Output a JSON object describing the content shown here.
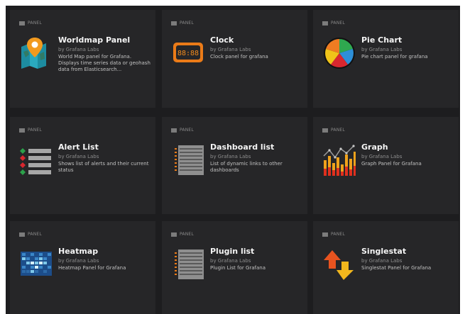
{
  "cards": [
    {
      "tag": "PANEL",
      "title": "Worldmap Panel",
      "author": "by Grafana Labs",
      "desc": "World Map panel for Grafana. Displays time series data or geohash data from Elasticsearch...",
      "logo": "worldmap-icon"
    },
    {
      "tag": "PANEL",
      "title": "Clock",
      "author": "by Grafana Labs",
      "desc": "Clock panel for grafana",
      "logo": "clock-icon",
      "logo_text": "88:88"
    },
    {
      "tag": "PANEL",
      "title": "Pie Chart",
      "author": "by Grafana Labs",
      "desc": "Pie chart panel for grafana",
      "logo": "pie-chart-icon"
    },
    {
      "tag": "PANEL",
      "title": "Alert List",
      "author": "by Grafana Labs",
      "desc": "Shows list of alerts and their current status",
      "logo": "alert-list-icon"
    },
    {
      "tag": "PANEL",
      "title": "Dashboard list",
      "author": "by Grafana Labs",
      "desc": "List of dynamic links to other dashboards",
      "logo": "dashboard-list-icon"
    },
    {
      "tag": "PANEL",
      "title": "Graph",
      "author": "by Grafana Labs",
      "desc": "Graph Panel for Grafana",
      "logo": "graph-icon"
    },
    {
      "tag": "PANEL",
      "title": "Heatmap",
      "author": "by Grafana Labs",
      "desc": "Heatmap Panel for Grafana",
      "logo": "heatmap-icon"
    },
    {
      "tag": "PANEL",
      "title": "Plugin list",
      "author": "by Grafana Labs",
      "desc": "Plugin List for Grafana",
      "logo": "plugin-list-icon"
    },
    {
      "tag": "PANEL",
      "title": "Singlestat",
      "author": "by Grafana Labs",
      "desc": "Singlestat Panel for Grafana",
      "logo": "singlestat-icon"
    }
  ],
  "colors": {
    "background": "#1d1d1f",
    "card": "#262628",
    "title": "#f4f4f4",
    "accent_orange": "#eb7b18"
  }
}
